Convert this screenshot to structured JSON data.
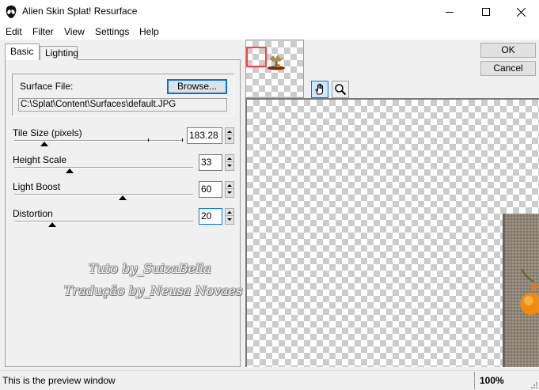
{
  "window": {
    "title": "Alien Skin Splat! Resurface",
    "icon": "alien-skin-icon"
  },
  "menu": [
    "Edit",
    "Filter",
    "View",
    "Settings",
    "Help"
  ],
  "tabs": [
    {
      "label": "Basic",
      "selected": true
    },
    {
      "label": "Lighting",
      "selected": false
    }
  ],
  "surface": {
    "label": "Surface File:",
    "browse_label": "Browse...",
    "path": "C:\\Splat\\Content\\Surfaces\\default.JPG"
  },
  "sliders": [
    {
      "label": "Tile Size (pixels)",
      "value": "183.28"
    },
    {
      "label": "Height Scale",
      "value": "33"
    },
    {
      "label": "Light Boost",
      "value": "60"
    },
    {
      "label": "Distortion",
      "value": "20"
    }
  ],
  "watermark": {
    "line1": "Tuto by_SuizaBella",
    "line2": "Tradução by_Neusa Novaes"
  },
  "buttons": {
    "ok": "OK",
    "cancel": "Cancel"
  },
  "tools": [
    "hand-icon",
    "magnifier-icon"
  ],
  "status": {
    "text": "This is the preview window",
    "zoom": "100%"
  }
}
